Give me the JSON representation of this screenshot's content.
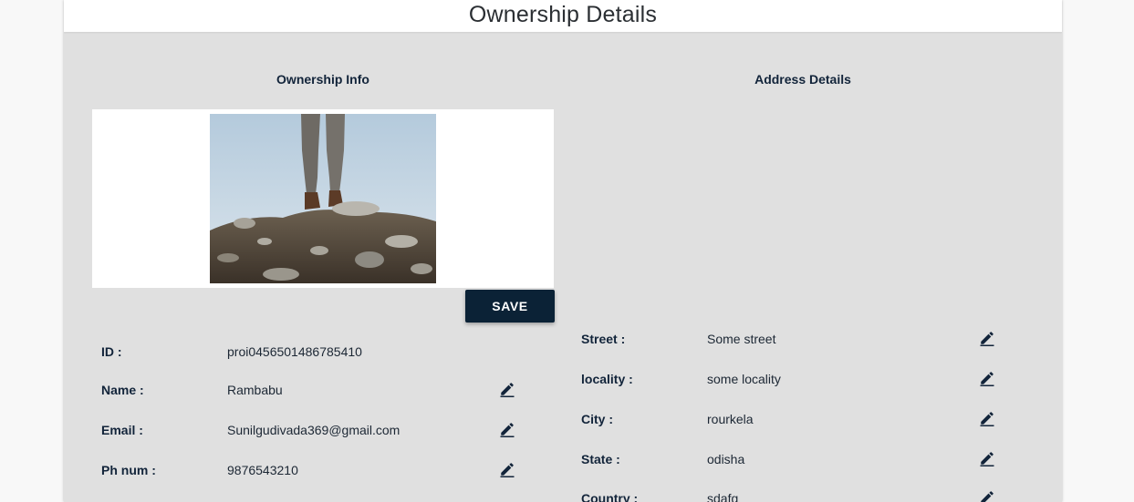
{
  "page": {
    "title": "Ownership Details"
  },
  "ownership": {
    "section_title": "Ownership Info",
    "save_label": "SAVE",
    "fields": [
      {
        "label": "ID :",
        "value": "proi0456501486785410",
        "editable": false
      },
      {
        "label": "Name :",
        "value": "Rambabu",
        "editable": true
      },
      {
        "label": "Email :",
        "value": "Sunilgudivada369@gmail.com",
        "editable": true
      },
      {
        "label": "Ph num :",
        "value": "9876543210",
        "editable": true
      }
    ]
  },
  "address": {
    "section_title": "Address Details",
    "fields": [
      {
        "label": "Street :",
        "value": "Some street",
        "editable": true
      },
      {
        "label": "locality :",
        "value": "some locality",
        "editable": true
      },
      {
        "label": "City :",
        "value": "rourkela",
        "editable": true
      },
      {
        "label": "State :",
        "value": "odisha",
        "editable": true
      },
      {
        "label": "Country :",
        "value": "sdafg",
        "editable": true
      }
    ]
  },
  "icons": {
    "edit": "pencil-edit-icon"
  },
  "colors": {
    "card_background": "#e0e0e0",
    "save_button": "#0b2236",
    "label_text": "#12243a"
  }
}
